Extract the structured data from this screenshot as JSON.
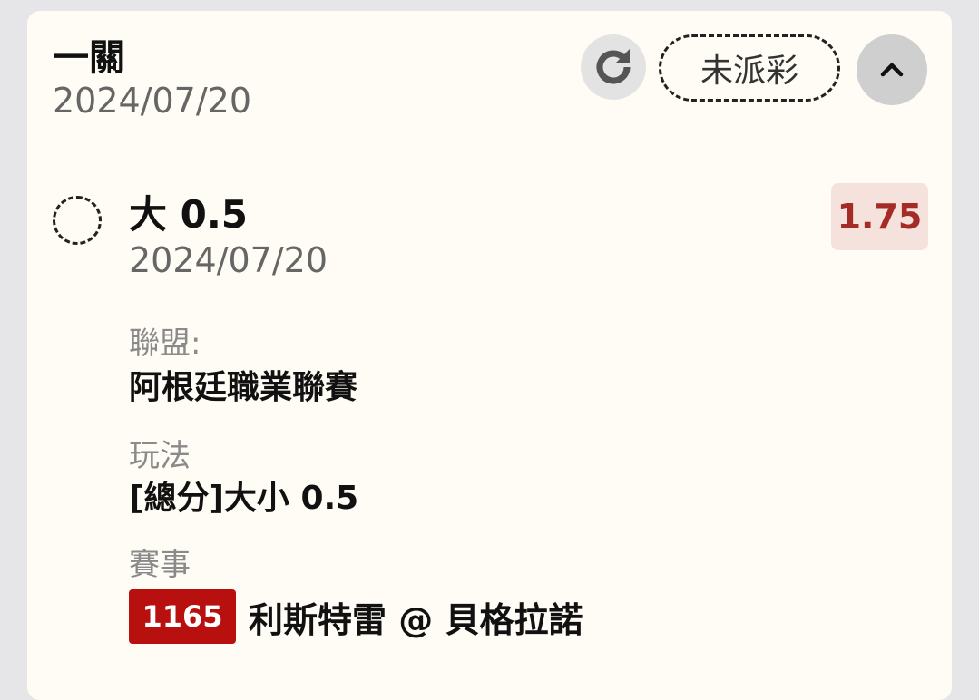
{
  "bet": {
    "type": "一關",
    "date": "2024/07/20",
    "status": "未派彩"
  },
  "icons": {
    "refresh": "refresh-icon",
    "collapse": "chevron-up-icon",
    "select": "dashed-circle"
  },
  "selection": {
    "title": "大 0.5",
    "date": "2024/07/20",
    "odds": "1.75"
  },
  "details": {
    "league_label": "聯盟:",
    "league_value": "阿根廷職業聯賽",
    "play_label": "玩法",
    "play_value": "[總分]大小 0.5",
    "event_label": "賽事",
    "match_id": "1165",
    "match_name": "利斯特雷 @ 貝格拉諾"
  },
  "colors": {
    "odds_text": "#a52b26",
    "odds_bg": "#f6e2dc",
    "badge_bg": "#b8100f",
    "card_bg": "#fefcf4"
  }
}
